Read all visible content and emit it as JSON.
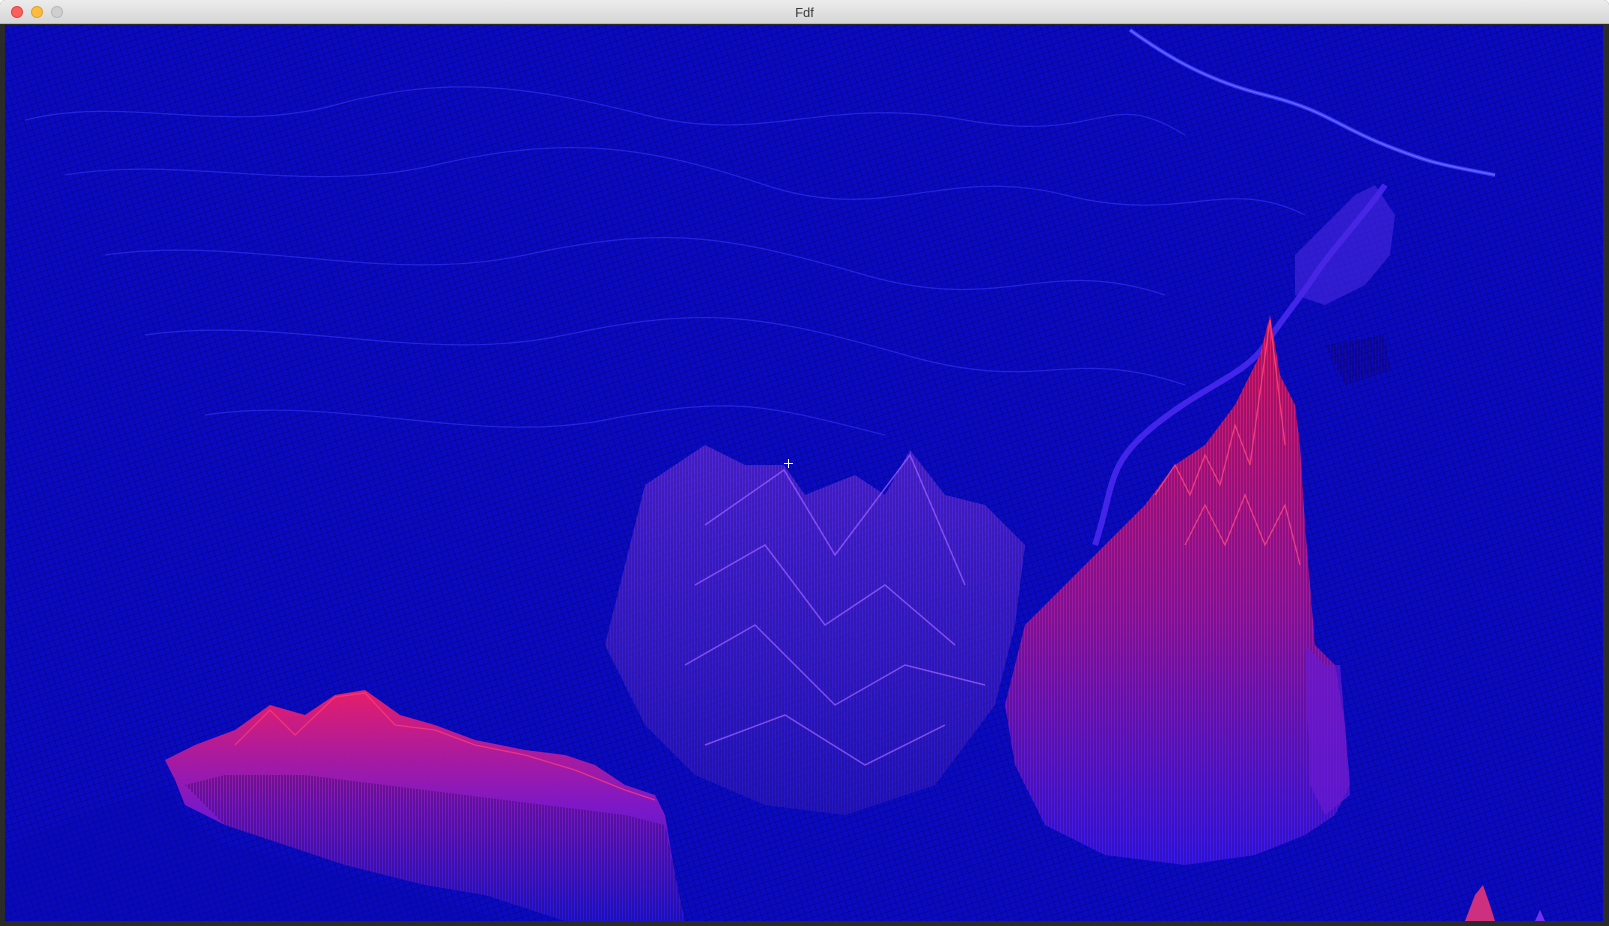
{
  "window": {
    "title": "Fdf"
  },
  "colors": {
    "background": "#0a0ac4",
    "wire_low": "#2a1aff",
    "wire_high": "#ff1a55",
    "grid_dark": "#05055a"
  },
  "viewport": {
    "content": "isometric-wireframe-heightmap"
  }
}
